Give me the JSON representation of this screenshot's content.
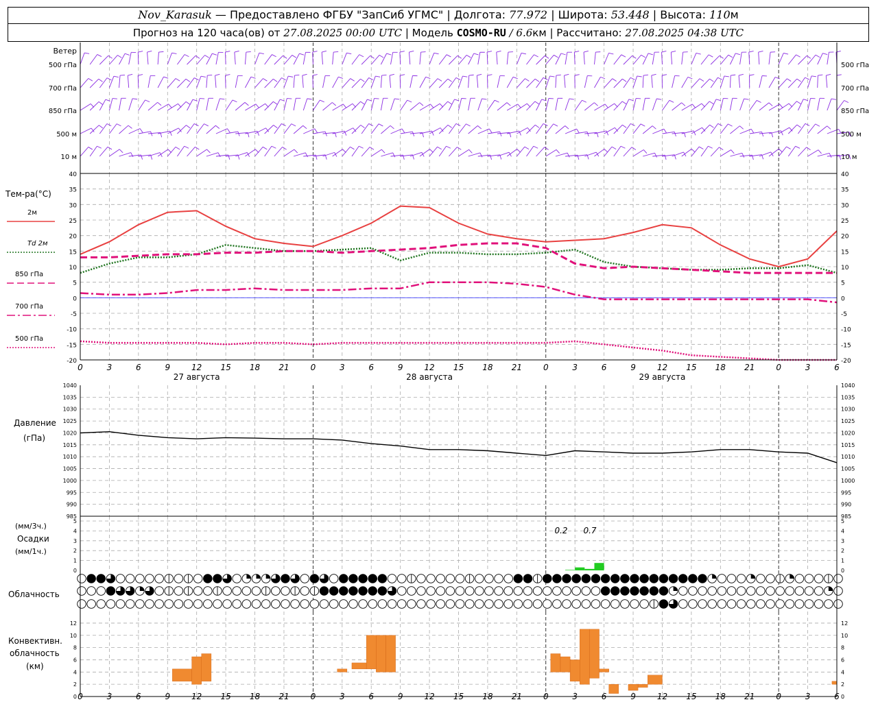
{
  "header": {
    "station": "Nov_Karasuk",
    "provided_by": " — Предоставлено ФГБУ \"ЗапСиб УГМС\" | Долгота: ",
    "longitude": "77.972",
    "lat_label": " | Широта: ",
    "latitude": "53.448",
    "alt_label": " | Высота: ",
    "altitude": "110",
    "alt_unit": "м",
    "forecast_prefix": "Прогноз на 120 часа(ов) от ",
    "forecast_start": "27.08.2025 00:00 UTC",
    "model_label": " | Модель ",
    "model": "COSMO-RU",
    "model_res": " / 6.6",
    "res_unit": "км",
    "calc_label": " | Рассчитано: ",
    "calc_time": "27.08.2025 04:38 UTC"
  },
  "wind_panel": {
    "title": "Ветер",
    "levels": [
      "500 гПа",
      "700 гПа",
      "850 гПа",
      "500 м",
      "10  м"
    ],
    "color": "#8a2be2"
  },
  "temp_panel": {
    "title": "Тем-ра(°C)",
    "legend": [
      {
        "label": "2м",
        "color": "#e84040",
        "style": "solid"
      },
      {
        "label": "Td  2м",
        "color": "#207520",
        "style": "dotted"
      },
      {
        "label": "850 гПа",
        "color": "#e0107a",
        "style": "dashed"
      },
      {
        "label": "700 гПа",
        "color": "#e0107a",
        "style": "dashdot"
      },
      {
        "label": "500 гПа",
        "color": "#e0107a",
        "style": "dotted"
      }
    ],
    "y_ticks": [
      "40",
      "35",
      "30",
      "25",
      "20",
      "15",
      "10",
      "5",
      "0",
      "-5",
      "-10",
      "-15",
      "-20"
    ]
  },
  "x_axis": {
    "hour_labels": [
      "0",
      "3",
      "6",
      "9",
      "12",
      "15",
      "18",
      "21",
      "0",
      "3",
      "6",
      "9",
      "12",
      "15",
      "18",
      "21",
      "0",
      "3",
      "6",
      "9",
      "12",
      "15",
      "18",
      "21",
      "0",
      "3",
      "6"
    ],
    "day_labels": [
      "27 августа",
      "28 августа",
      "29 августа"
    ]
  },
  "pressure_panel": {
    "title": "Давление",
    "unit": "(гПа)",
    "y_ticks": [
      "1040",
      "1035",
      "1030",
      "1025",
      "1020",
      "1015",
      "1010",
      "1005",
      "1000",
      "995",
      "990",
      "985"
    ]
  },
  "precip_panel": {
    "unit3h": "(мм/3ч.)",
    "title": "Осадки",
    "unit1h": "(мм/1ч.)",
    "y_ticks": [
      "5",
      "4",
      "3",
      "2",
      "1",
      "0"
    ],
    "annotations": [
      "0.2",
      "0.7"
    ],
    "color": "#22cc22"
  },
  "cloud_panel": {
    "title": "Облачность"
  },
  "conv_panel": {
    "title1": "Конвективн.",
    "title2": "облачность",
    "unit": "(км)",
    "y_ticks": [
      "12",
      "10",
      "8",
      "6",
      "4",
      "2",
      "0"
    ],
    "color": "#f08a30"
  },
  "chart_data": [
    {
      "type": "line",
      "title": "Тем-ра(°C)",
      "ylim": [
        -20,
        40
      ],
      "x_hours": [
        0,
        3,
        6,
        9,
        12,
        15,
        18,
        21,
        24,
        27,
        30,
        33,
        36,
        39,
        42,
        45,
        48,
        51,
        54,
        57,
        60,
        63,
        66,
        69,
        72,
        75,
        78
      ],
      "series": [
        {
          "name": "2м",
          "values": [
            14,
            18,
            23.5,
            27.5,
            28,
            23,
            19,
            17.5,
            16.5,
            20,
            24,
            29.5,
            29,
            24,
            20.5,
            19,
            18,
            18.5,
            19,
            21,
            23.5,
            22.5,
            17,
            12.5,
            10,
            12.5,
            21.5
          ]
        },
        {
          "name": "Td 2м",
          "values": [
            8,
            11,
            13,
            13,
            14,
            17,
            16,
            15,
            15,
            15.5,
            16,
            12,
            14.5,
            14.5,
            14,
            14,
            14.5,
            15.5,
            11.5,
            10,
            9.5,
            9,
            9,
            9.5,
            9.5,
            10.5,
            8
          ]
        },
        {
          "name": "850 гПа",
          "values": [
            13,
            13,
            13.5,
            14,
            14,
            14.5,
            14.5,
            15,
            15,
            14.5,
            15,
            15.5,
            16,
            17,
            17.5,
            17.5,
            16,
            11,
            9.5,
            10,
            9.5,
            9,
            8.5,
            8,
            8,
            8,
            8
          ]
        },
        {
          "name": "700 гПа",
          "values": [
            1.5,
            1,
            1,
            1.5,
            2.5,
            2.5,
            3,
            2.5,
            2.5,
            2.5,
            3,
            3,
            5,
            5,
            5,
            4.5,
            3.5,
            1,
            -0.5,
            -0.5,
            -0.5,
            -0.5,
            -0.5,
            -0.5,
            -0.5,
            -0.5,
            -1.5
          ]
        },
        {
          "name": "500 гПа",
          "values": [
            -14,
            -14.5,
            -14.5,
            -14.5,
            -14.5,
            -15,
            -14.5,
            -14.5,
            -15,
            -14.5,
            -14.5,
            -14.5,
            -14.5,
            -14.5,
            -14.5,
            -14.5,
            -14.5,
            -14,
            -15,
            -16,
            -17,
            -18.5,
            -19,
            -19.5,
            -20,
            -20,
            -20
          ]
        }
      ]
    },
    {
      "type": "line",
      "title": "Давление",
      "ylim": [
        985,
        1040
      ],
      "x_hours": [
        0,
        3,
        6,
        9,
        12,
        15,
        18,
        21,
        24,
        27,
        30,
        33,
        36,
        39,
        42,
        45,
        48,
        51,
        54,
        57,
        60,
        63,
        66,
        69,
        72,
        75,
        78
      ],
      "series": [
        {
          "name": "Давление",
          "values": [
            1020,
            1020.5,
            1019,
            1018,
            1017.5,
            1018,
            1017.8,
            1017.5,
            1017.5,
            1017,
            1015.5,
            1014.5,
            1013,
            1013,
            1012.5,
            1011.5,
            1010.5,
            1012.5,
            1012,
            1011.5,
            1011.5,
            1012,
            1013,
            1013,
            1012,
            1011.5,
            1007.5
          ]
        }
      ]
    },
    {
      "type": "bar",
      "title": "Осадки",
      "ylim": [
        0,
        5
      ],
      "x_hours": [
        50,
        51,
        52,
        53
      ],
      "values": [
        0.05,
        0.3,
        0.15,
        0.75
      ]
    },
    {
      "type": "bar",
      "title": "Конвективн. облачность (км)",
      "ylim": [
        0,
        13
      ],
      "bars": [
        {
          "x0": 9.5,
          "x1": 11.5,
          "bottom": 2.5,
          "top": 4.5
        },
        {
          "x0": 11.5,
          "x1": 12.5,
          "bottom": 2,
          "top": 6.5
        },
        {
          "x0": 12.5,
          "x1": 13.5,
          "bottom": 2.5,
          "top": 7
        },
        {
          "x0": 26.5,
          "x1": 27.5,
          "bottom": 4,
          "top": 4.5
        },
        {
          "x0": 28,
          "x1": 29.5,
          "bottom": 4.5,
          "top": 5.5
        },
        {
          "x0": 29.5,
          "x1": 30.5,
          "bottom": 4.5,
          "top": 10
        },
        {
          "x0": 30.5,
          "x1": 31.5,
          "bottom": 4,
          "top": 10
        },
        {
          "x0": 31.5,
          "x1": 32.5,
          "bottom": 4,
          "top": 10
        },
        {
          "x0": 48.5,
          "x1": 49.5,
          "bottom": 4,
          "top": 7
        },
        {
          "x0": 49.5,
          "x1": 50.5,
          "bottom": 4,
          "top": 6.5
        },
        {
          "x0": 50.5,
          "x1": 51.5,
          "bottom": 2.5,
          "top": 6
        },
        {
          "x0": 51.5,
          "x1": 52.5,
          "bottom": 2,
          "top": 11
        },
        {
          "x0": 52.5,
          "x1": 53.5,
          "bottom": 3,
          "top": 11
        },
        {
          "x0": 53.5,
          "x1": 54.5,
          "bottom": 4,
          "top": 4.5
        },
        {
          "x0": 54.5,
          "x1": 55.5,
          "bottom": 0.5,
          "top": 2
        },
        {
          "x0": 56.5,
          "x1": 57.5,
          "bottom": 1,
          "top": 2
        },
        {
          "x0": 57.5,
          "x1": 58.5,
          "bottom": 1.5,
          "top": 2
        },
        {
          "x0": 58.5,
          "x1": 60,
          "bottom": 2,
          "top": 3.5
        },
        {
          "x0": 77.5,
          "x1": 78,
          "bottom": 2,
          "top": 2.5
        }
      ]
    },
    {
      "type": "heatmap",
      "title": "Облачность",
      "note": "cloud cover per hour, 3 rows (upper / middle / lower), 0 = clear … 4 = overcast, values at hours 0..78",
      "rows": [
        [
          0,
          4,
          4,
          3,
          0,
          0,
          0,
          0,
          0,
          1,
          0,
          1,
          0,
          4,
          4,
          3,
          0,
          2,
          2,
          2,
          3,
          4,
          3,
          0,
          4,
          3,
          0,
          4,
          4,
          4,
          4,
          4,
          0,
          0,
          1,
          0,
          0,
          0,
          0,
          0,
          1,
          0,
          0,
          0,
          0,
          4,
          4,
          1,
          4,
          4,
          4,
          4,
          4,
          4,
          4,
          4,
          4,
          4,
          4,
          4,
          4,
          4,
          4,
          4,
          4,
          2,
          0,
          0,
          0,
          2,
          0,
          0,
          1,
          2,
          0,
          0,
          0,
          1,
          0,
          0,
          0,
          1
        ],
        [
          0,
          0,
          0,
          4,
          3,
          3,
          2,
          3,
          0,
          1,
          0,
          1,
          0,
          0,
          1,
          0,
          0,
          0,
          0,
          1,
          0,
          0,
          1,
          0,
          1,
          4,
          4,
          4,
          4,
          4,
          4,
          4,
          3,
          0,
          0,
          0,
          0,
          0,
          0,
          0,
          0,
          0,
          0,
          0,
          0,
          0,
          0,
          0,
          0,
          0,
          0,
          0,
          0,
          0,
          4,
          4,
          4,
          4,
          4,
          4,
          4,
          2,
          0,
          0,
          0,
          0,
          0,
          0,
          0,
          0,
          0,
          0,
          0,
          0,
          0,
          0,
          0,
          2,
          0,
          1
        ],
        [
          0,
          0,
          0,
          0,
          0,
          0,
          0,
          0,
          0,
          0,
          0,
          0,
          0,
          0,
          0,
          0,
          0,
          0,
          0,
          0,
          0,
          0,
          0,
          0,
          0,
          0,
          0,
          0,
          0,
          0,
          0,
          0,
          0,
          0,
          0,
          0,
          0,
          0,
          0,
          0,
          0,
          0,
          0,
          0,
          0,
          0,
          0,
          0,
          0,
          0,
          0,
          0,
          0,
          0,
          0,
          0,
          0,
          0,
          0,
          1,
          4,
          3,
          0,
          0,
          0,
          0,
          0,
          0,
          0,
          0,
          0,
          0,
          0,
          0,
          0,
          0,
          0,
          0,
          0
        ]
      ]
    }
  ]
}
